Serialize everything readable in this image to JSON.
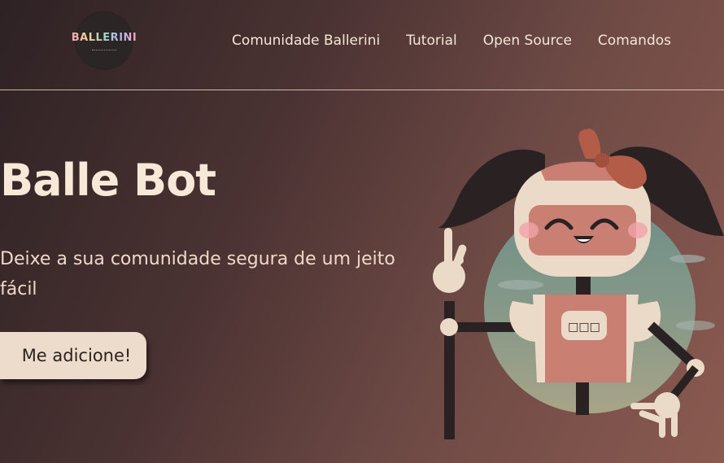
{
  "nav": {
    "logo_text": "BALLERINI",
    "links": [
      "Comunidade Ballerini",
      "Tutorial",
      "Open Source",
      "Comandos"
    ]
  },
  "hero": {
    "title": "Balle Bot",
    "subtitle": "Deixe a sua comunidade segura de um jeito fácil",
    "cta_label": "Me adicione!"
  },
  "colors": {
    "background_dark": "#2e2224",
    "background_light": "#8a5a50",
    "cream": "#eddccb",
    "accent_pink": "#c97f72",
    "hair": "#2a2122"
  },
  "illustration": {
    "chest_display": "□□□"
  }
}
